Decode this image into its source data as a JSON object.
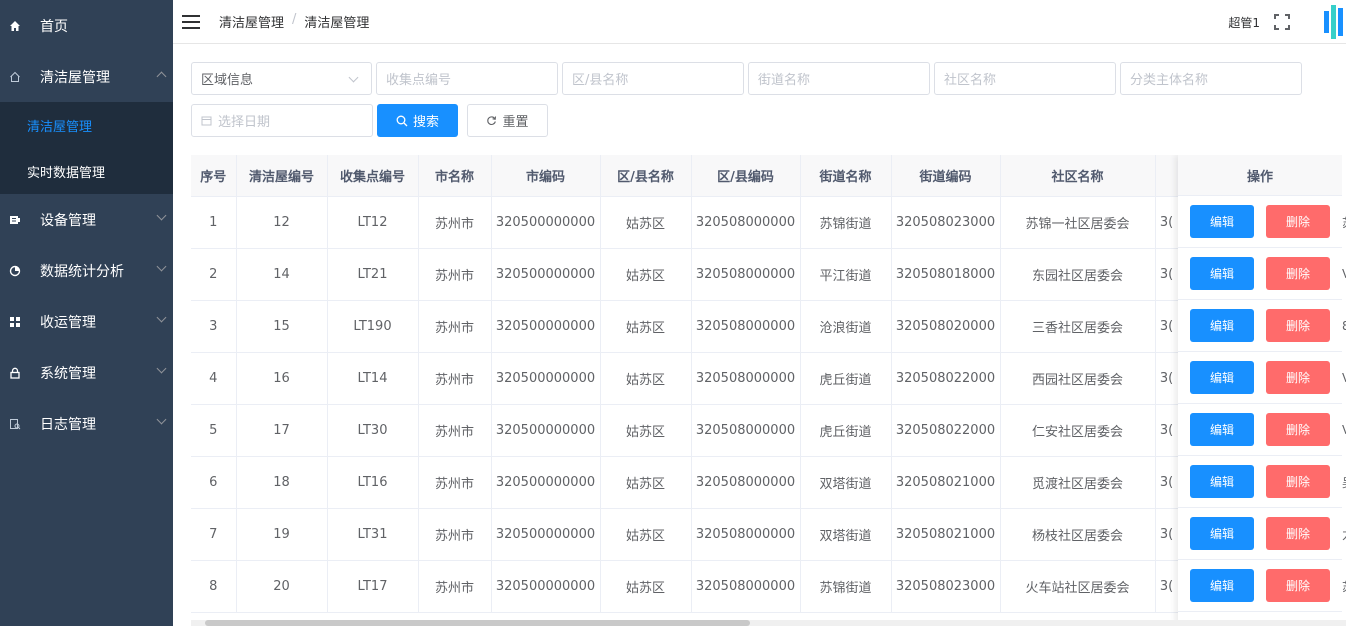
{
  "sidebar": {
    "items": [
      {
        "label": "首页",
        "icon": "home-icon"
      },
      {
        "label": "清洁屋管理",
        "icon": "house-outline-icon",
        "expanded": true
      },
      {
        "label": "设备管理",
        "icon": "device-icon"
      },
      {
        "label": "数据统计分析",
        "icon": "pie-chart-icon"
      },
      {
        "label": "收运管理",
        "icon": "grid-icon"
      },
      {
        "label": "系统管理",
        "icon": "lock-icon"
      },
      {
        "label": "日志管理",
        "icon": "log-icon"
      }
    ],
    "subitems": [
      {
        "label": "清洁屋管理",
        "active": true
      },
      {
        "label": "实时数据管理",
        "active": false
      }
    ]
  },
  "header": {
    "breadcrumb": [
      "清洁屋管理",
      "清洁屋管理"
    ],
    "separator": "/",
    "username": "超管1"
  },
  "filters": {
    "region_select": "区域信息",
    "placeholders": [
      "收集点编号",
      "区/县名称",
      "街道名称",
      "社区名称",
      "分类主体名称"
    ],
    "date_placeholder": "选择日期",
    "search_label": "搜索",
    "reset_label": "重置"
  },
  "table": {
    "columns": [
      "序号",
      "清洁屋编号",
      "收集点编号",
      "市名称",
      "市编码",
      "区/县名称",
      "区/县编码",
      "街道名称",
      "街道编码",
      "社区名称",
      ""
    ],
    "ops_header": "操作",
    "edit_label": "编辑",
    "delete_label": "删除",
    "rows": [
      [
        "1",
        "12",
        "LT12",
        "苏州市",
        "320500000000",
        "姑苏区",
        "320508000000",
        "苏锦街道",
        "320508023000",
        "苏锦一社区居委会",
        "3("
      ],
      [
        "2",
        "14",
        "LT21",
        "苏州市",
        "320500000000",
        "姑苏区",
        "320508000000",
        "平江街道",
        "320508018000",
        "东园社区居委会",
        "3("
      ],
      [
        "3",
        "15",
        "LT190",
        "苏州市",
        "320500000000",
        "姑苏区",
        "320508000000",
        "沧浪街道",
        "320508020000",
        "三香社区居委会",
        "3("
      ],
      [
        "4",
        "16",
        "LT14",
        "苏州市",
        "320500000000",
        "姑苏区",
        "320508000000",
        "虎丘街道",
        "320508022000",
        "西园社区居委会",
        "3("
      ],
      [
        "5",
        "17",
        "LT30",
        "苏州市",
        "320500000000",
        "姑苏区",
        "320508000000",
        "虎丘街道",
        "320508022000",
        "仁安社区居委会",
        "3("
      ],
      [
        "6",
        "18",
        "LT16",
        "苏州市",
        "320500000000",
        "姑苏区",
        "320508000000",
        "双塔街道",
        "320508021000",
        "觅渡社区居委会",
        "3("
      ],
      [
        "7",
        "19",
        "LT31",
        "苏州市",
        "320500000000",
        "姑苏区",
        "320508000000",
        "双塔街道",
        "320508021000",
        "杨枝社区居委会",
        "3("
      ],
      [
        "8",
        "20",
        "LT17",
        "苏州市",
        "320500000000",
        "姑苏区",
        "320508000000",
        "苏锦街道",
        "320508023000",
        "火车站社区居委会",
        "3("
      ]
    ],
    "edge_glyphs": [
      "苏",
      "V",
      "8",
      "V",
      "V",
      "吴",
      "力",
      "苏"
    ]
  },
  "colors": {
    "sidebar_bg": "#304156",
    "submenu_bg": "#1f2d3d",
    "primary": "#1890ff",
    "danger": "#ff6b6b"
  }
}
